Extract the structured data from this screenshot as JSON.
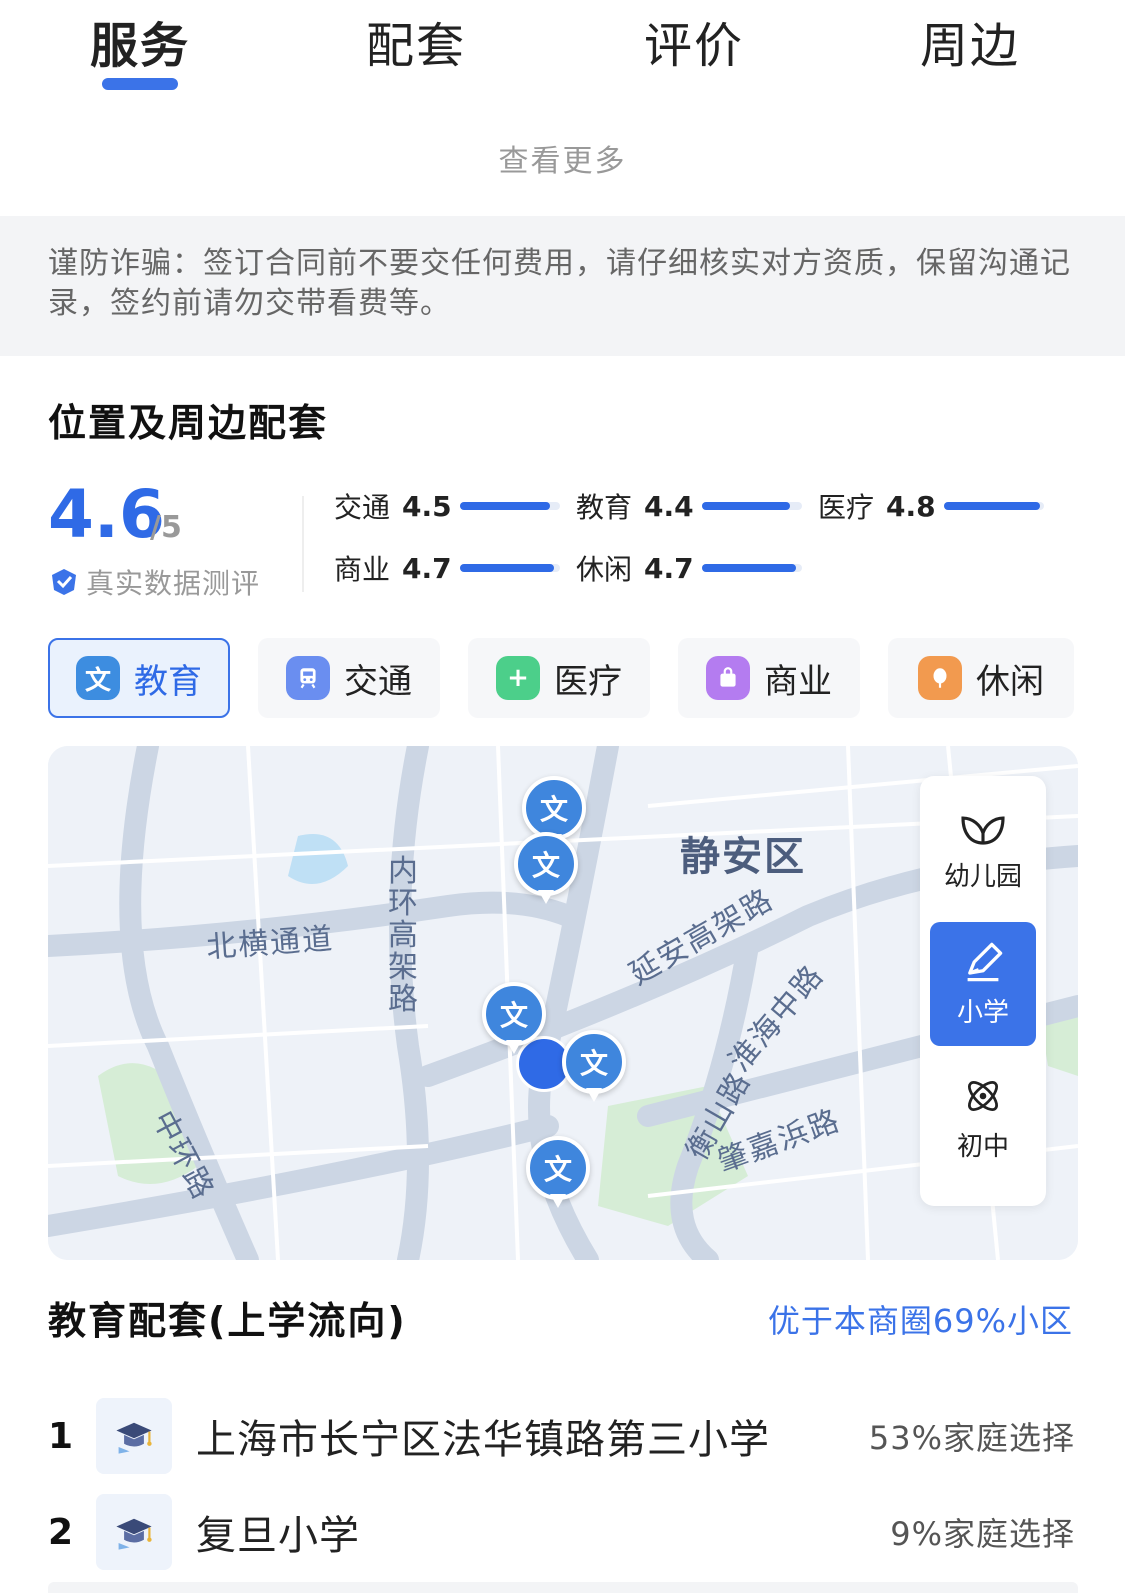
{
  "tabs": [
    {
      "label": "服务",
      "active": true
    },
    {
      "label": "配套",
      "active": false
    },
    {
      "label": "评价",
      "active": false
    },
    {
      "label": "周边",
      "active": false
    }
  ],
  "see_more": "查看更多",
  "notice": "谨防诈骗：签订合同前不要交任何费用，请仔细核实对方资质，保留沟通记录，签约前请勿交带看费等。",
  "location": {
    "title": "位置及周边配套",
    "score": "4.6",
    "score_max": "/5",
    "verified_label": "真实数据测评",
    "metrics": [
      {
        "label": "交通",
        "value": "4.5",
        "fraction": 0.9
      },
      {
        "label": "教育",
        "value": "4.4",
        "fraction": 0.88
      },
      {
        "label": "医疗",
        "value": "4.8",
        "fraction": 0.96
      },
      {
        "label": "商业",
        "value": "4.7",
        "fraction": 0.94
      },
      {
        "label": "休闲",
        "value": "4.7",
        "fraction": 0.94
      }
    ]
  },
  "categories": [
    {
      "label": "教育",
      "icon": "文",
      "color": "#3d8de0",
      "active": true
    },
    {
      "label": "交通",
      "icon": "train",
      "color": "#6a8ef0",
      "active": false
    },
    {
      "label": "医疗",
      "icon": "+",
      "color": "#4ccf8a",
      "active": false
    },
    {
      "label": "商业",
      "icon": "bag",
      "color": "#b47cf0",
      "active": false
    },
    {
      "label": "休闲",
      "icon": "leaf",
      "color": "#f29a4f",
      "active": false
    }
  ],
  "map": {
    "district": "静安区",
    "road_labels": [
      "北横通道",
      "内环高架路",
      "延安高架路",
      "淮海中路",
      "衡山路",
      "肇嘉浜路",
      "中环路"
    ],
    "pin_glyph": "文",
    "levels": [
      {
        "label": "幼儿园",
        "icon": "sprout-icon",
        "active": false
      },
      {
        "label": "小学",
        "icon": "pencil-icon",
        "active": true
      },
      {
        "label": "初中",
        "icon": "atom-icon",
        "active": false
      }
    ]
  },
  "education": {
    "title": "教育配套(上学流向)",
    "comparison": "优于本商圈69%小区",
    "schools": [
      {
        "rank": "1",
        "name": "上海市长宁区法华镇路第三小学",
        "share": "53%家庭选择"
      },
      {
        "rank": "2",
        "name": "复旦小学",
        "share": "9%家庭选择"
      }
    ]
  }
}
